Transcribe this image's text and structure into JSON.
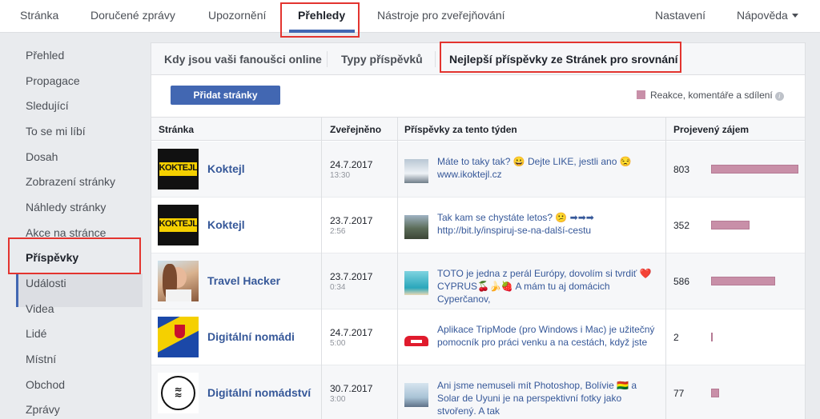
{
  "topnav": {
    "items": [
      "Stránka",
      "Doručené zprávy",
      "Upozornění",
      "Přehledy",
      "Nástroje pro zveřejňování"
    ],
    "settings": "Nastavení",
    "help": "Nápověda"
  },
  "sidebar": {
    "items": [
      "Přehled",
      "Propagace",
      "Sledující",
      "To se mi líbí",
      "Dosah",
      "Zobrazení stránky",
      "Náhledy stránky",
      "Akce na stránce",
      "Příspěvky",
      "Události",
      "Videa",
      "Lidé",
      "Místní",
      "Obchod",
      "Zprávy"
    ]
  },
  "subtabs": [
    "Kdy jsou vaši fanoušci online",
    "Typy příspěvků",
    "Nejlepší příspěvky ze Stránek pro srovnání"
  ],
  "add_button": "Přidat stránky",
  "legend": {
    "label": "Reakce, komentáře a sdílení",
    "color": "#c88fa8"
  },
  "table": {
    "headers": [
      "Stránka",
      "Zveřejněno",
      "Příspěvky za tento týden",
      "Projevený zájem"
    ],
    "max_value": 803,
    "rows": [
      {
        "page": "Koktejl",
        "date": "24.7.2017",
        "time": "13:30",
        "post": "Máte to taky tak? 😀 Dejte LIKE, jestli ano 😒 www.ikoktejl.cz",
        "value": "803"
      },
      {
        "page": "Koktejl",
        "date": "23.7.2017",
        "time": "2:56",
        "post": "Tak kam se chystáte letos? 😕 ➡➡➡ http://bit.ly/inspiruj-se-na-další-cestu",
        "value": "352"
      },
      {
        "page": "Travel Hacker",
        "date": "23.7.2017",
        "time": "0:34",
        "post": "TOTO je jedna z perál Európy, dovolím si tvrdiť ❤️ CYPRUS🍒🍌🍓 A mám tu aj domácich Cyperčanov,",
        "value": "586"
      },
      {
        "page": "Digitální nomádi",
        "date": "24.7.2017",
        "time": "5:00",
        "post": "Aplikace TripMode (pro Windows i Mac) je užitečný pomocník pro práci venku a na cestách, když jste",
        "value": "2"
      },
      {
        "page": "Digitální nomádství",
        "date": "30.7.2017",
        "time": "3:00",
        "post": "Ani jsme nemuseli mít Photoshop, Bolívie 🇧🇴 a Solar de Uyuni je na perspektivní fotky jako stvořený. A tak",
        "value": "77"
      }
    ]
  },
  "colors": {
    "accent": "#4267b2",
    "link": "#365899",
    "highlight": "#e3342f",
    "bar": "#c88fa8"
  }
}
